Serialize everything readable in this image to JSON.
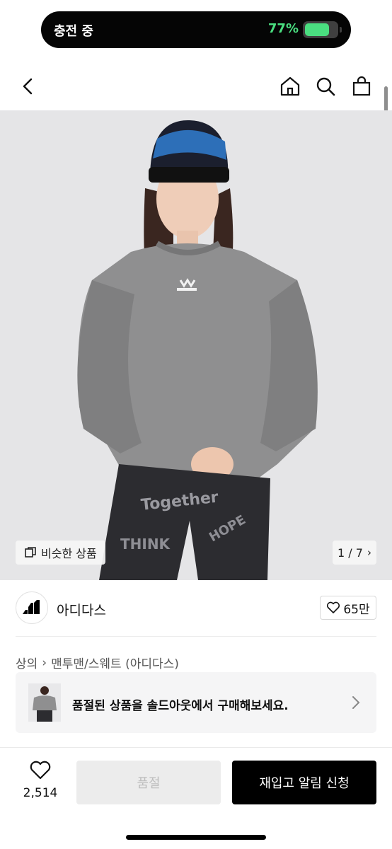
{
  "status_bar": {
    "charging_label": "충전 중",
    "battery_percent_text": "77%",
    "battery_level": 0.77,
    "accent_color": "#4ade80"
  },
  "top_nav": {
    "icons": [
      "back-icon",
      "home-icon",
      "search-icon",
      "cart-icon"
    ]
  },
  "product_image": {
    "similar_label": "비슷한 상품",
    "counter": "1 / 7",
    "current_index": 1,
    "total_images": 7
  },
  "brand": {
    "name": "아디다스",
    "like_count": "65만"
  },
  "breadcrumb": {
    "items": [
      "상의",
      "맨투맨/스웨트 (아디다스)"
    ]
  },
  "soldout_banner": {
    "message": "품절된 상품을 솔드아웃에서 구매해보세요."
  },
  "bottom_bar": {
    "wish_count": "2,514",
    "soldout_label": "품절",
    "restock_label": "재입고 알림 신청"
  }
}
